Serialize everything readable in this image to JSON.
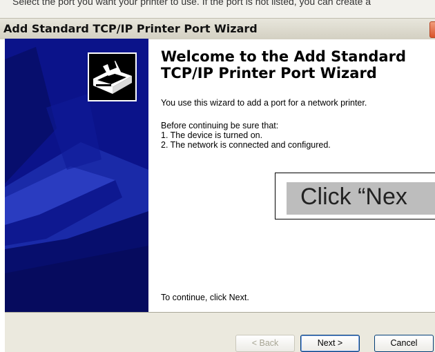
{
  "background_dialog": {
    "text": "Select the port you want your printer to use.  If the port is not listed, you can create a"
  },
  "window": {
    "title": "Add Standard TCP/IP Printer Port Wizard"
  },
  "content": {
    "heading_line1": "Welcome to the Add Standard",
    "heading_line2": "TCP/IP Printer Port Wizard",
    "intro": "You use this wizard to add a port for a network printer.",
    "before": "Before continuing be sure that:",
    "item1": "1.  The device is turned on.",
    "item2": "2.  The network is connected and configured.",
    "continue": "To continue, click Next."
  },
  "callout": {
    "text": "Click “Nex"
  },
  "buttons": {
    "back": "< Back",
    "next": "Next >",
    "cancel": "Cancel"
  },
  "colors": {
    "banner": "#0b138a",
    "title_bar": "#d3d0c2",
    "button_bar": "#ebe9de",
    "callout_fill": "#bdbdbd"
  },
  "icons": {
    "wizard": "printer-wizard-icon",
    "close": "close-icon"
  }
}
